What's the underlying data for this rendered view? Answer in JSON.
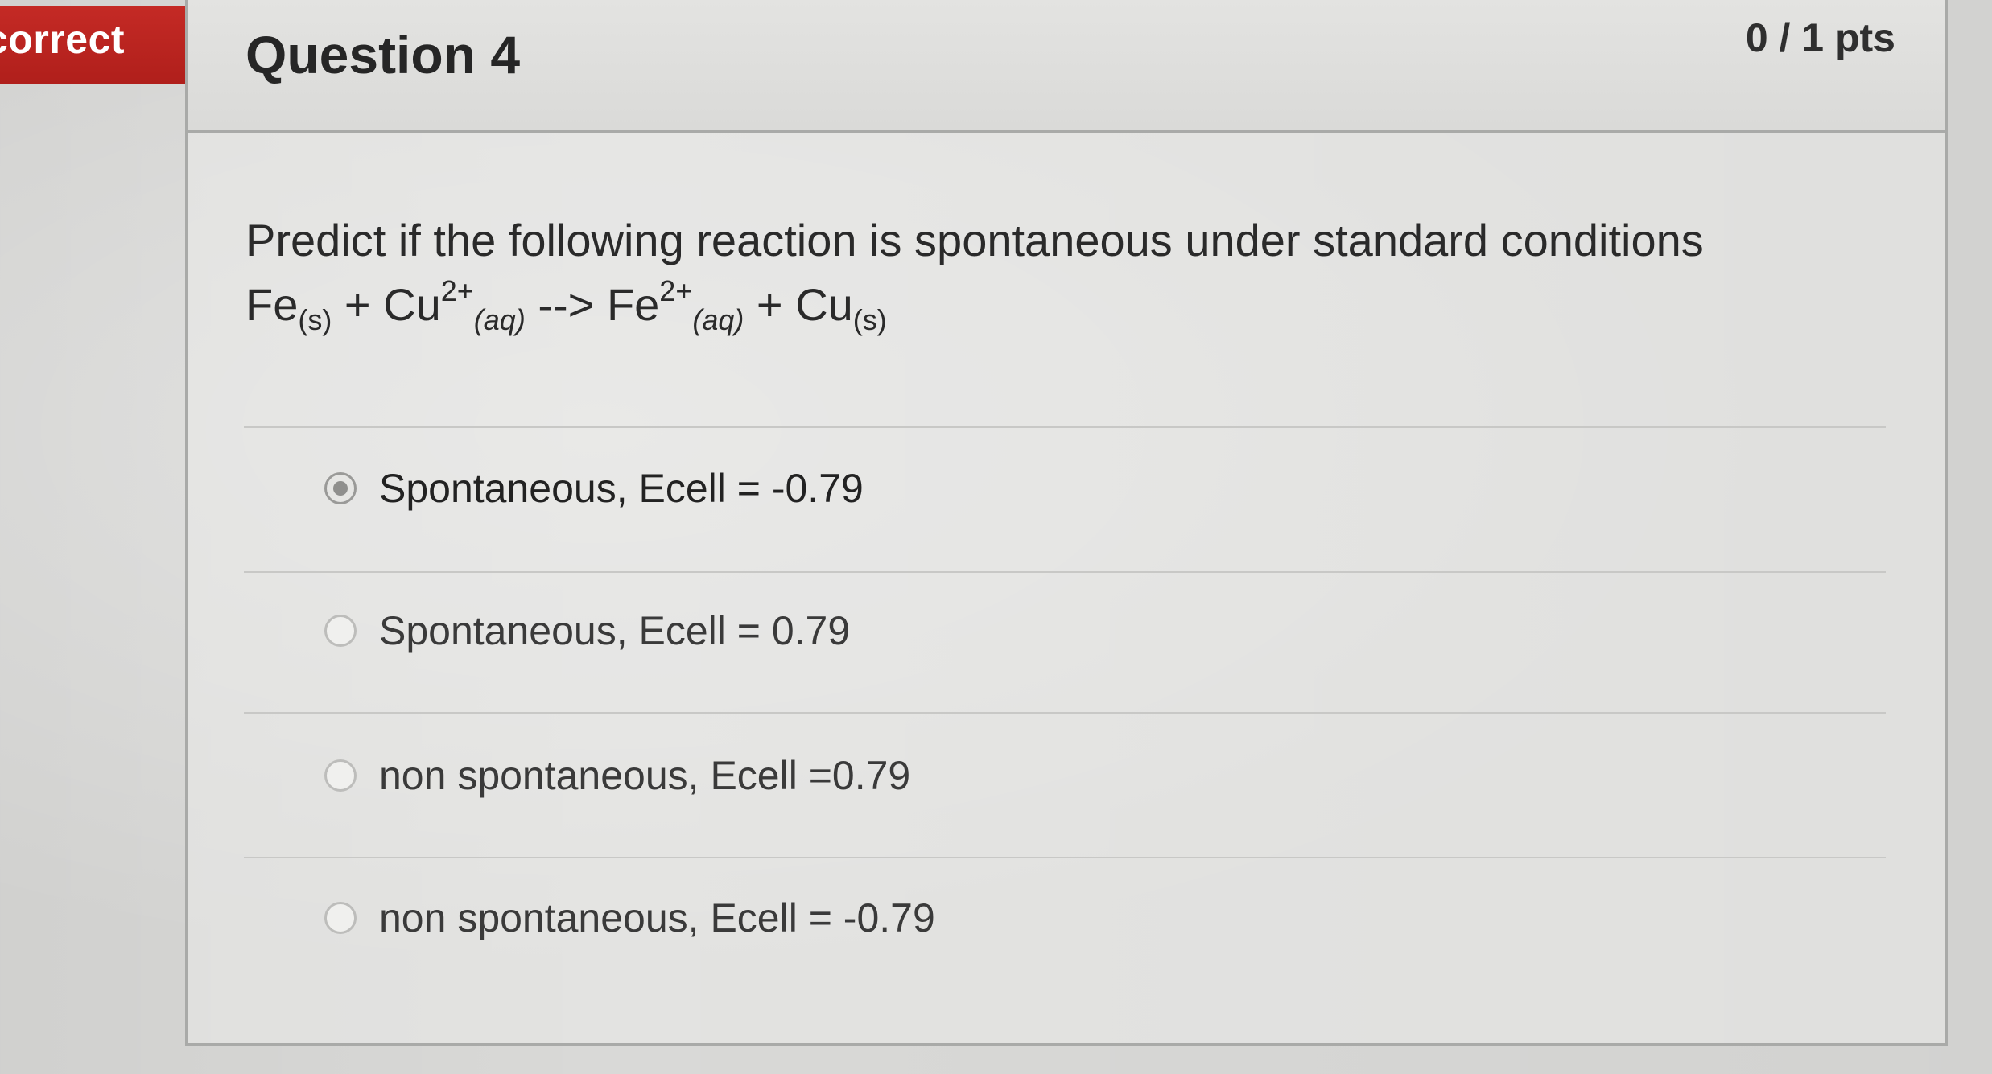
{
  "status_banner": {
    "label": "correct",
    "color": "#b5221e"
  },
  "question": {
    "title": "Question 4",
    "points": "0 / 1 pts",
    "prompt": "Predict if the following reaction is spontaneous under standard conditions",
    "equation": {
      "fe": "Fe",
      "s1": "(s)",
      "plus1": " + Cu",
      "cu_charge": "2+",
      "aq1": "(aq)",
      "arrow": " --> Fe",
      "fe_charge": "2+",
      "aq2": "(aq)",
      "plus2": " + Cu",
      "s2": "(s)"
    }
  },
  "answers": [
    {
      "label": "Spontaneous, Ecell = -0.79",
      "selected": true
    },
    {
      "label": "Spontaneous, Ecell = 0.79",
      "selected": false
    },
    {
      "label": "non spontaneous, Ecell =0.79",
      "selected": false
    },
    {
      "label": "non spontaneous, Ecell = -0.79",
      "selected": false
    }
  ]
}
